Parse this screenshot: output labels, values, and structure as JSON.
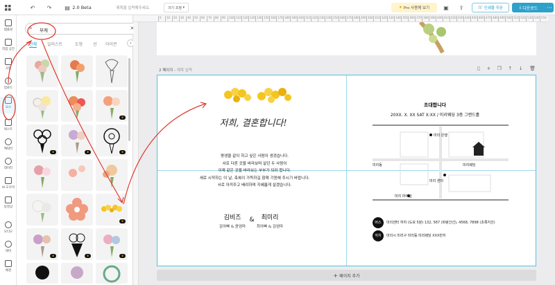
{
  "topbar": {
    "version": "2.0 Beta",
    "title_placeholder": "제목을 입력해주세요.",
    "size_label": "크기 조정",
    "pro_label": "Pro 사용해 보기",
    "print_label": "인쇄물 주문",
    "download_label": "다운로드",
    "more_label": "···"
  },
  "sidebar": {
    "items": [
      {
        "label": "템플릿",
        "icon": "template-icon"
      },
      {
        "label": "작업 공간",
        "icon": "workspace-icon"
      },
      {
        "label": "사진",
        "icon": "photo-icon"
      },
      {
        "label": "업로드",
        "icon": "upload-icon"
      },
      {
        "label": "요소",
        "icon": "elements-icon"
      },
      {
        "label": "텍스트",
        "icon": "text-icon"
      },
      {
        "label": "캐릭터",
        "icon": "character-icon"
      },
      {
        "label": "데이터",
        "icon": "data-icon"
      },
      {
        "label": "AI 도우미",
        "icon": "ai-icon"
      },
      {
        "label": "동영상",
        "icon": "video-icon"
      },
      {
        "label": "오디오",
        "icon": "audio-icon"
      },
      {
        "label": "테마",
        "icon": "theme-icon"
      },
      {
        "label": "배경",
        "icon": "background-icon"
      }
    ]
  },
  "panel": {
    "search_value": "부케",
    "tabs": [
      "전체",
      "일러스트",
      "도형",
      "선",
      "아이콘"
    ]
  },
  "page2": {
    "label": "2 페이지",
    "title_placeholder": "제목 입력",
    "add_page": "페이지 추가"
  },
  "invite": {
    "script_title": "저희, 결혼합니다!",
    "message": [
      "평생을 같이 하고 싶은 사람이 생겼습니다.",
      "서로 다른 곳을 바라보며 살던 두 사람이",
      "이제 같은 곳을 바라보는 부부가 되려 합니다.",
      "새로 시작하는 이 날, 축복이 가득하길 함께 기원해 주시기 바랍니다.",
      "서로 아끼주고 배려하며 지혜롭게 살겠습니다."
    ],
    "groom": "김비즈",
    "groom_parents": "김아빠 & 윤엄마",
    "amp": "&",
    "bride": "최미리",
    "bride_parents": "최아빠 & 김엄마",
    "invite_title": "초대합니다",
    "datetime": "20XX. X. XX SAT X:XX / 미리웨딩 3층 그랜드홀",
    "map_labels": {
      "bank": "미리 은행",
      "subway": "미리동",
      "venue": "미리웨딩",
      "center": "미리 센터",
      "mart": "미리 마이널"
    },
    "bus_badge": "버스",
    "bus_text": "미리센터 하차 (도보 5분) 132, 567 (파랑간선), 4568, 7898 (초록지선)",
    "car_badge": "자차",
    "car_text": "미리시 미리구 미리동 미리웨딩 XXX번지"
  },
  "colors": {
    "accent": "#1a9ed4",
    "download_bg": "#2ea1c9",
    "selection": "#4ec3e0",
    "annotation": "#e03a2c"
  },
  "ruler": {
    "ticks": [
      "0",
      "10",
      "20",
      "30",
      "40",
      "50",
      "60",
      "70",
      "80",
      "90",
      "100",
      "110",
      "120",
      "130",
      "140",
      "150",
      "160",
      "170",
      "180",
      "190",
      "200",
      "210",
      "220",
      "230",
      "240",
      "250",
      "260",
      "270",
      "280",
      "290",
      "300",
      "310",
      "320",
      "330",
      "340",
      "350",
      "360",
      "370",
      "380",
      "390",
      "400",
      "410",
      "420",
      "430",
      "440",
      "450",
      "460",
      "470",
      "480",
      "490",
      "500",
      "510",
      "520",
      "530",
      "540",
      "550"
    ]
  }
}
